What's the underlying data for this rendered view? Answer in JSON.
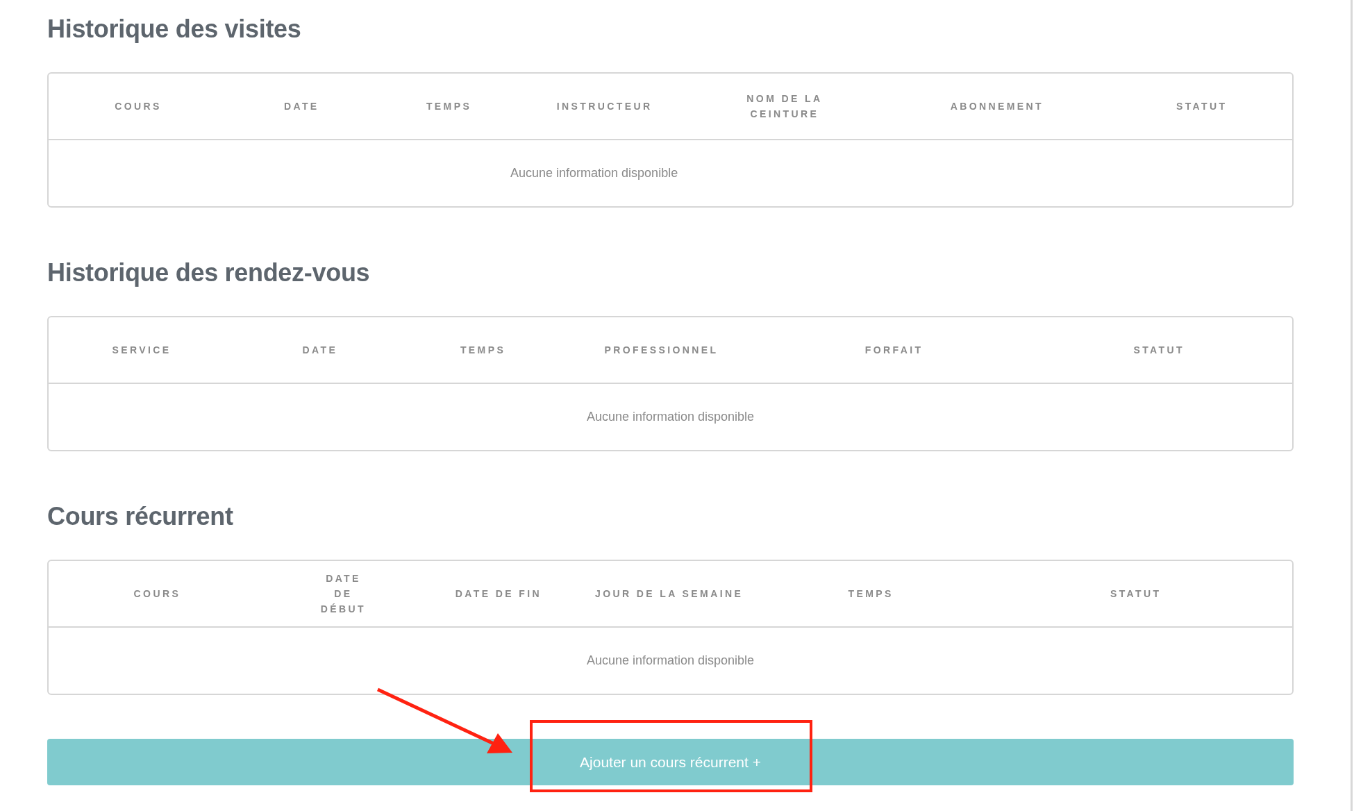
{
  "sections": [
    {
      "title": "Historique des visites",
      "columns": [
        "COURS",
        "DATE",
        "TEMPS",
        "INSTRUCTEUR",
        "NOM DE LA CEINTURE",
        "ABONNEMENT",
        "STATUT"
      ],
      "empty_message": "Aucune information disponible"
    },
    {
      "title": "Historique des rendez-vous",
      "columns": [
        "SERVICE",
        "DATE",
        "TEMPS",
        "PROFESSIONNEL",
        "FORFAIT",
        "STATUT"
      ],
      "empty_message": "Aucune information disponible"
    },
    {
      "title": "Cours récurrent",
      "columns": [
        "COURS",
        "DATE DE DÉBUT",
        "DATE DE FIN",
        "JOUR DE LA SEMAINE",
        "TEMPS",
        "STATUT"
      ],
      "empty_message": "Aucune information disponible"
    }
  ],
  "add_button": {
    "label": "Ajouter un cours récurrent +"
  }
}
